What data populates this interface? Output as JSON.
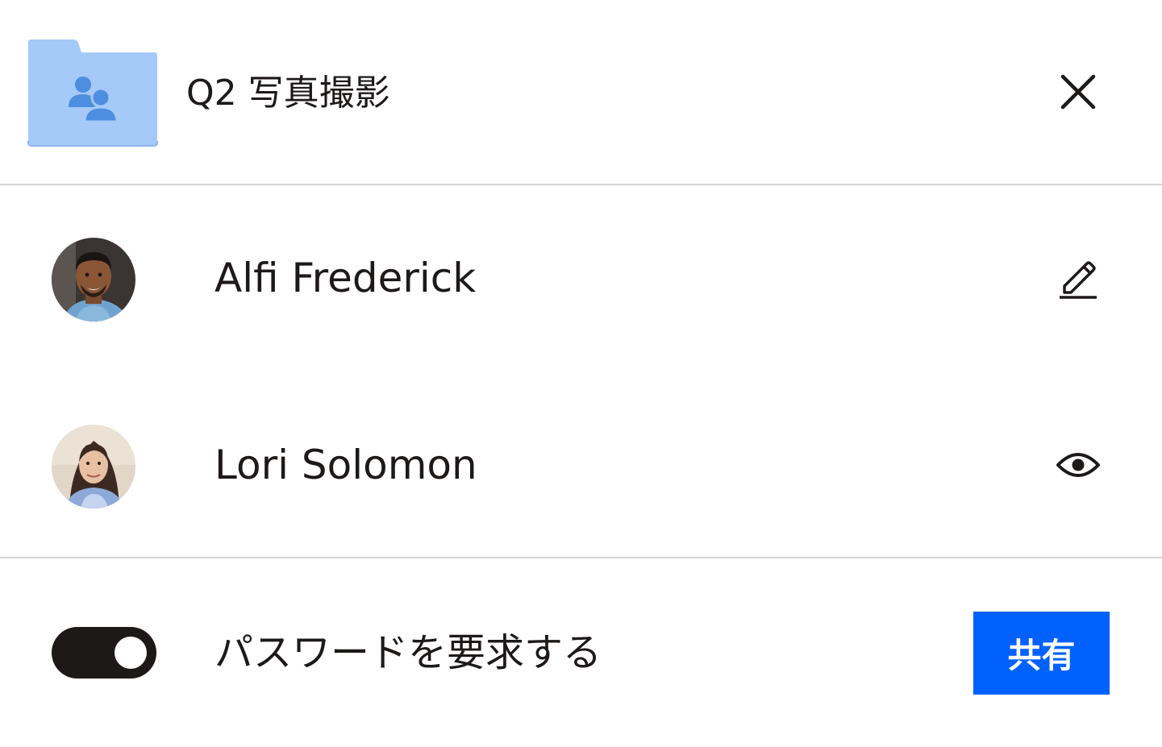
{
  "folder": {
    "title": "Q2 写真撮影",
    "icon": "shared-folder-icon",
    "icon_color": "#a5c9f8",
    "icon_figure_color": "#4d8ee0"
  },
  "header": {
    "close_icon": "close-icon"
  },
  "members": [
    {
      "name": "Alfi Frederick",
      "avatar": "avatar-photo",
      "permission_icon": "pencil-icon"
    },
    {
      "name": "Lori Solomon",
      "avatar": "avatar-photo",
      "permission_icon": "eye-icon"
    }
  ],
  "footer": {
    "toggle_label": "パスワードを要求する",
    "toggle_on": true,
    "share_label": "共有"
  },
  "colors": {
    "text": "#1e1919",
    "divider": "#d6d4d1",
    "accent": "#0061fe"
  }
}
